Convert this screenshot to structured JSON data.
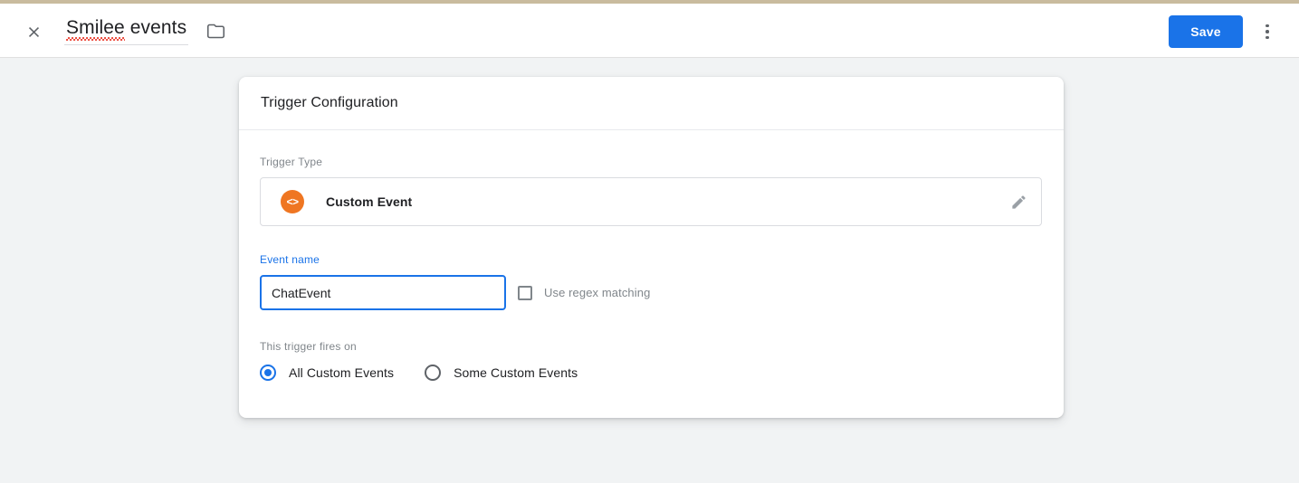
{
  "browser": {
    "top_strip_color": "#c9bb9e"
  },
  "header": {
    "close_icon": "close-icon",
    "title_misspelled": "Smilee",
    "title_rest": " events",
    "folder_icon": "folder-icon",
    "save_label": "Save",
    "save_color": "#1a73e8",
    "overflow_icon": "more-vert-icon"
  },
  "card": {
    "title": "Trigger Configuration",
    "trigger_type": {
      "label": "Trigger Type",
      "icon": "code-brackets-icon",
      "icon_glyph": "<>",
      "icon_color": "#ef7622",
      "value": "Custom Event",
      "edit_icon": "pencil-icon"
    },
    "event_name": {
      "label": "Event name",
      "label_color": "#1a73e8",
      "value": "ChatEvent",
      "placeholder": "",
      "regex_checkbox_label": "Use regex matching",
      "regex_checked": false
    },
    "fires_on": {
      "label": "This trigger fires on",
      "options": [
        {
          "label": "All Custom Events",
          "selected": true
        },
        {
          "label": "Some Custom Events",
          "selected": false
        }
      ]
    }
  }
}
